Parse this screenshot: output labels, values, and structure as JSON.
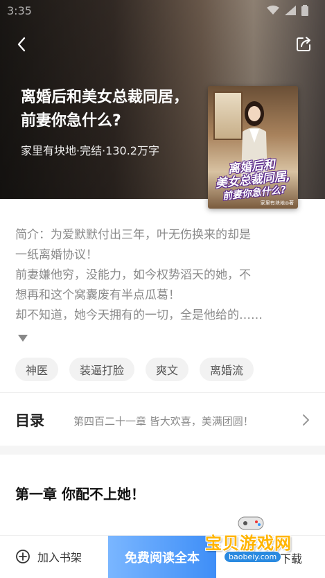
{
  "status_bar": {
    "time": "3:35"
  },
  "book": {
    "title": "离婚后和美女总裁同居，前妻你急什么?",
    "meta": "家里有块地·完结·130.2万字",
    "cover_title_line1": "离婚后和",
    "cover_title_line2": "美女总裁同居,",
    "cover_title_line3": "前妻你急什么?",
    "cover_author": "家里有块地◎著"
  },
  "synopsis": {
    "lines": [
      "简介：为爱默默付出三年，叶无伤换来的却是",
      "一纸离婚协议！",
      "前妻嫌他穷，没能力，如今权势滔天的她，不",
      "想再和这个窝囊废有半点瓜葛！",
      "却不知道，她今天拥有的一切，全是他给的……"
    ]
  },
  "tags": [
    "神医",
    "装逼打脸",
    "爽文",
    "离婚流"
  ],
  "catalog": {
    "label": "目录",
    "latest_chapter": "第四百二十一章 皆大欢喜，美满团圆！"
  },
  "first_chapter": {
    "title": "第一章  你配不上她！"
  },
  "bottom_bar": {
    "add_bookshelf": "加入书架",
    "read_free": "免费阅读全本",
    "download": "下载"
  },
  "watermark": {
    "name": "宝贝游戏网",
    "url": "baobeiy.com"
  },
  "colors": {
    "accent": "#3e8ef7",
    "tag_bg": "#f2f2f2",
    "watermark": "#ffb400"
  }
}
